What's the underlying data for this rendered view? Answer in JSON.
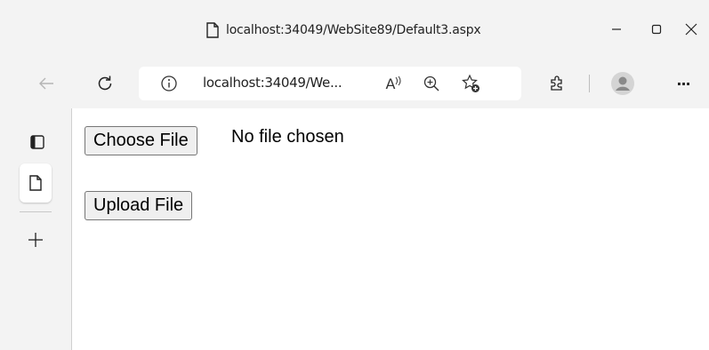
{
  "window": {
    "title": "localhost:34049/WebSite89/Default3.aspx"
  },
  "toolbar": {
    "address_text": "localhost:34049/We...",
    "read_aloud_label": "A",
    "more_label": "···"
  },
  "sidebar": {
    "items": [
      {
        "icon": "tab-actions-icon"
      },
      {
        "icon": "page-icon",
        "active": true
      },
      {
        "icon": "plus-icon"
      }
    ]
  },
  "page": {
    "choose_file_label": "Choose File",
    "file_status": "No file chosen",
    "upload_label": "Upload File"
  }
}
